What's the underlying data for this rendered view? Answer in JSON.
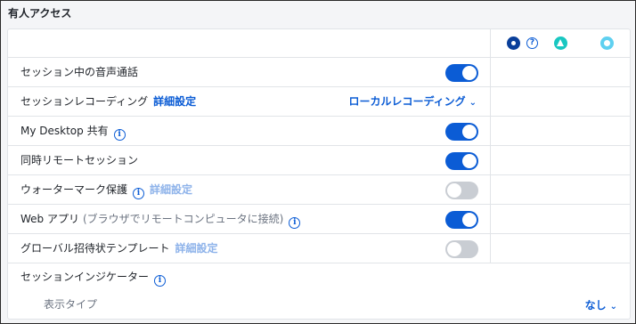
{
  "section_title": "有人アクセス",
  "colors": {
    "accent": "#0b5cd5",
    "toggle_off": "#c9cdd3",
    "link_muted": "#8eb3ea"
  },
  "header_icons": [
    "dot-circle-icon",
    "help-icon",
    "triangle-icon",
    "ring-icon"
  ],
  "help_glyph": "?",
  "info_glyph": "i",
  "chevron_glyph": "⌄",
  "rows": [
    {
      "label": "セッション中の音声通話",
      "toggle": true
    },
    {
      "label": "セッションレコーディング",
      "link": "詳細設定",
      "dropdown": "ローカルレコーディング"
    },
    {
      "label": "My Desktop 共有",
      "info": true,
      "toggle": true
    },
    {
      "label": "同時リモートセッション",
      "toggle": true
    },
    {
      "label": "ウォーターマーク保護",
      "info": true,
      "link": "詳細設定",
      "toggle": false
    },
    {
      "label": "Web アプリ",
      "sub": "(ブラウザでリモートコンピュータに接続)",
      "info": true,
      "toggle": true
    },
    {
      "label": "グローバル招待状テンプレート",
      "link": "詳細設定",
      "toggle": false
    }
  ],
  "indicator": {
    "label": "セッションインジケーター"
  },
  "display_type": {
    "label": "表示タイプ",
    "value": "なし"
  }
}
